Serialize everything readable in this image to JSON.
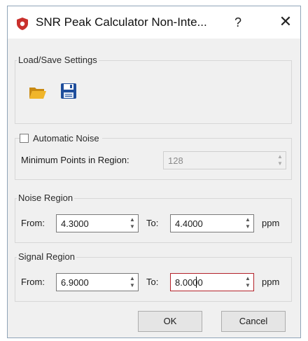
{
  "window": {
    "title": "SNR Peak Calculator Non-Inte...",
    "help": "?",
    "close": "✕",
    "app_icon": "shield-icon",
    "accent_color": "#c9302c"
  },
  "load_save": {
    "title": "Load/Save Settings",
    "open_icon": "folder-open-icon",
    "save_icon": "floppy-disk-icon"
  },
  "automatic_noise": {
    "label": "Automatic Noise",
    "checked": false,
    "min_points_label": "Minimum Points in Region:",
    "min_points_value": "128"
  },
  "noise_region": {
    "title": "Noise Region",
    "from_label": "From:",
    "from_value": "4.3000",
    "to_label": "To:",
    "to_value": "4.4000",
    "unit": "ppm"
  },
  "signal_region": {
    "title": "Signal Region",
    "from_label": "From:",
    "from_value": "6.9000",
    "to_label": "To:",
    "to_value": "8.0000",
    "unit": "ppm"
  },
  "buttons": {
    "ok": "OK",
    "cancel": "Cancel"
  }
}
